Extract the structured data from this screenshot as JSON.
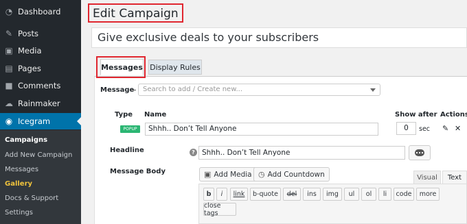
{
  "sidebar": {
    "items": [
      {
        "label": "Dashboard",
        "icon": "dashboard-icon"
      },
      {
        "label": "Posts",
        "icon": "pin-icon"
      },
      {
        "label": "Media",
        "icon": "media-icon"
      },
      {
        "label": "Pages",
        "icon": "pages-icon"
      },
      {
        "label": "Comments",
        "icon": "comment-icon"
      },
      {
        "label": "Rainmaker",
        "icon": "cloud-icon"
      },
      {
        "label": "Icegram",
        "icon": "icegram-icon"
      }
    ],
    "submenu": [
      "Campaigns",
      "Add New Campaign",
      "Messages",
      "Gallery",
      "Docs & Support",
      "Settings"
    ]
  },
  "page": {
    "title": "Edit Campaign",
    "campaign_title": "Give exclusive deals to your subscribers"
  },
  "tabs": {
    "messages": "Messages",
    "display_rules": "Display Rules"
  },
  "message_row": {
    "label": "Message",
    "placeholder": "Search to add / Create new..."
  },
  "table": {
    "col_type": "Type",
    "col_name": "Name",
    "col_show_after": "Show after",
    "col_actions": "Actions",
    "type_badge": "POPUP",
    "name_value": "Shhh..  Don’t Tell Anyone",
    "show_after_value": "0",
    "sec_label": "sec"
  },
  "headline": {
    "label": "Headline",
    "value": "Shhh..  Don’t Tell Anyone"
  },
  "body": {
    "label": "Message Body",
    "add_media": "Add Media",
    "add_countdown": "Add Countdown",
    "tab_visual": "Visual",
    "tab_text": "Text"
  },
  "quicktags": [
    "b",
    "i",
    "link",
    "b-quote",
    "del",
    "ins",
    "img",
    "ul",
    "ol",
    "li",
    "code",
    "more",
    "close tags"
  ],
  "colors": {
    "sidebar_bg": "#23282d",
    "active_blue": "#0073aa",
    "highlight_red": "#e0262f",
    "popup_green": "#2bb673",
    "gallery_gold": "#f0c33c"
  }
}
